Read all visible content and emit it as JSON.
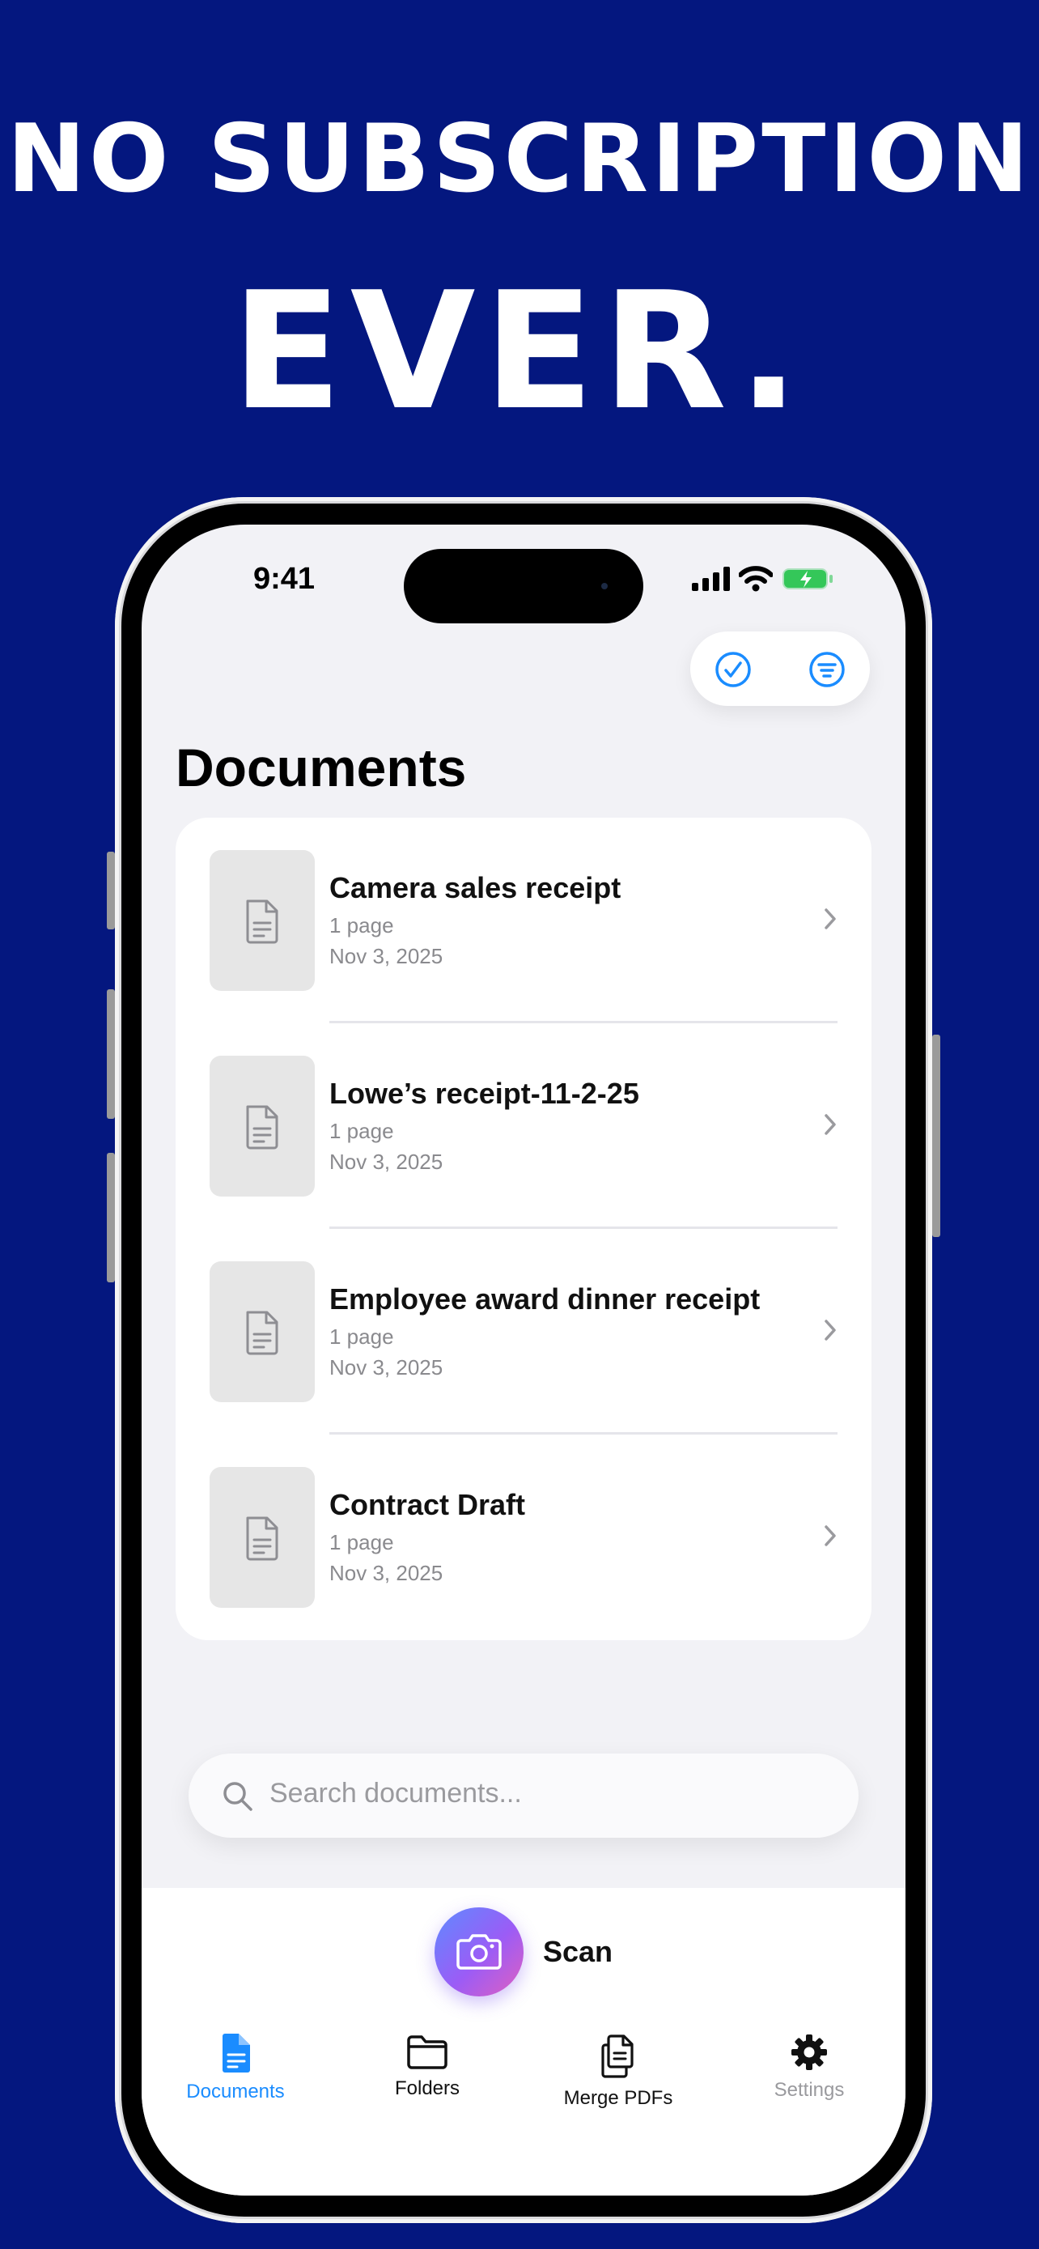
{
  "headline": {
    "line1": "NO SUBSCRIPTION",
    "line2": "EVER."
  },
  "status_bar": {
    "time": "9:41"
  },
  "colors": {
    "background": "#04177f",
    "accent": "#1a8cff",
    "battery": "#34c759"
  },
  "top_actions": [
    {
      "icon": "checkmark-circle-icon"
    },
    {
      "icon": "filter-icon"
    }
  ],
  "page_title": "Documents",
  "documents": [
    {
      "title": "Camera sales receipt",
      "pages": "1 page",
      "date": "Nov 3, 2025"
    },
    {
      "title": "Lowe’s receipt-11-2-25",
      "pages": "1 page",
      "date": "Nov 3, 2025"
    },
    {
      "title": "Employee award dinner receipt",
      "pages": "1 page",
      "date": "Nov 3, 2025"
    },
    {
      "title": "Contract Draft",
      "pages": "1 page",
      "date": "Nov 3, 2025"
    }
  ],
  "search": {
    "placeholder": "Search documents..."
  },
  "scan": {
    "label": "Scan"
  },
  "tabs": [
    {
      "label": "Documents",
      "icon": "document-icon",
      "state": "active"
    },
    {
      "label": "Folders",
      "icon": "folder-icon",
      "state": "normal"
    },
    {
      "label": "Merge PDFs",
      "icon": "merge-pdfs-icon",
      "state": "normal"
    },
    {
      "label": "Settings",
      "icon": "gear-icon",
      "state": "disabled"
    }
  ]
}
